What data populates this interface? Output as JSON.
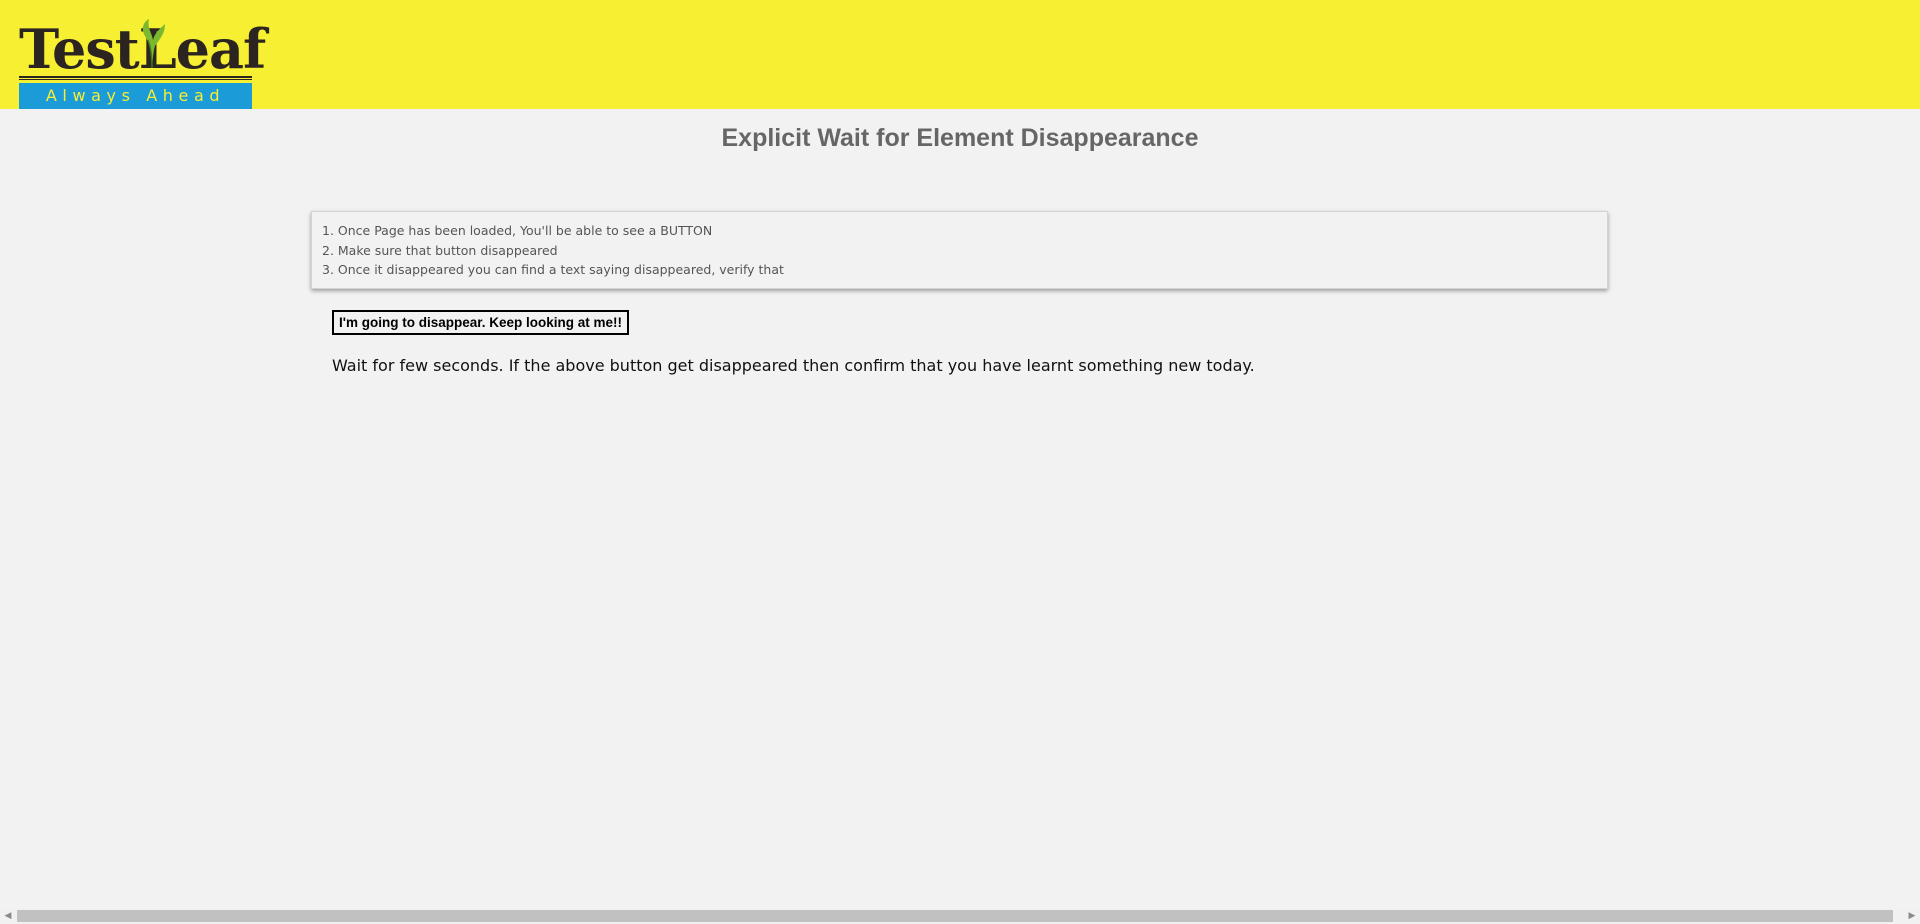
{
  "header": {
    "bg_color": "#f7ef31",
    "logo": {
      "brand": "TestLeaf",
      "tagline": "Always Ahead",
      "band_color": "#1b9bd7"
    }
  },
  "page": {
    "title": "Explicit Wait for Element Disappearance"
  },
  "instructions": [
    "1. Once Page has been loaded, You'll be able to see a BUTTON",
    "2. Make sure that button disappeared",
    "3. Once it disappeared you can find a text saying disappeared, verify that"
  ],
  "button": {
    "label": "I'm going to disappear. Keep looking at me!!"
  },
  "message": "Wait for few seconds. If the above button get disappeared then confirm that you have learnt something new today.",
  "icons": {
    "scroll_left": "scroll-left-arrow-icon",
    "scroll_right": "scroll-right-arrow-icon"
  }
}
